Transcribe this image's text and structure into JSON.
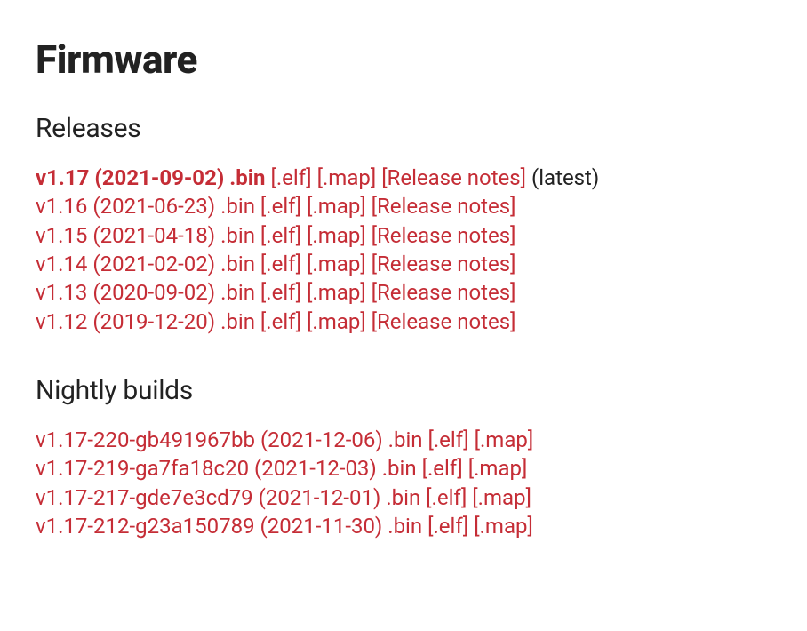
{
  "heading": "Firmware",
  "sections": {
    "releases": {
      "title": "Releases",
      "items": [
        {
          "version": "v1.17",
          "date": "2021-09-02",
          "files": [
            ".bin",
            "[.elf]",
            "[.map]",
            "[Release notes]"
          ],
          "suffix": "(latest)",
          "bold": true
        },
        {
          "version": "v1.16",
          "date": "2021-06-23",
          "files": [
            ".bin",
            "[.elf]",
            "[.map]",
            "[Release notes]"
          ]
        },
        {
          "version": "v1.15",
          "date": "2021-04-18",
          "files": [
            ".bin",
            "[.elf]",
            "[.map]",
            "[Release notes]"
          ]
        },
        {
          "version": "v1.14",
          "date": "2021-02-02",
          "files": [
            ".bin",
            "[.elf]",
            "[.map]",
            "[Release notes]"
          ]
        },
        {
          "version": "v1.13",
          "date": "2020-09-02",
          "files": [
            ".bin",
            "[.elf]",
            "[.map]",
            "[Release notes]"
          ]
        },
        {
          "version": "v1.12",
          "date": "2019-12-20",
          "files": [
            ".bin",
            "[.elf]",
            "[.map]",
            "[Release notes]"
          ]
        }
      ]
    },
    "nightly": {
      "title": "Nightly builds",
      "items": [
        {
          "version": "v1.17-220-gb491967bb",
          "date": "2021-12-06",
          "files": [
            ".bin",
            "[.elf]",
            "[.map]"
          ]
        },
        {
          "version": "v1.17-219-ga7fa18c20",
          "date": "2021-12-03",
          "files": [
            ".bin",
            "[.elf]",
            "[.map]"
          ]
        },
        {
          "version": "v1.17-217-gde7e3cd79",
          "date": "2021-12-01",
          "files": [
            ".bin",
            "[.elf]",
            "[.map]"
          ]
        },
        {
          "version": "v1.17-212-g23a150789",
          "date": "2021-11-30",
          "files": [
            ".bin",
            "[.elf]",
            "[.map]"
          ]
        }
      ]
    }
  }
}
